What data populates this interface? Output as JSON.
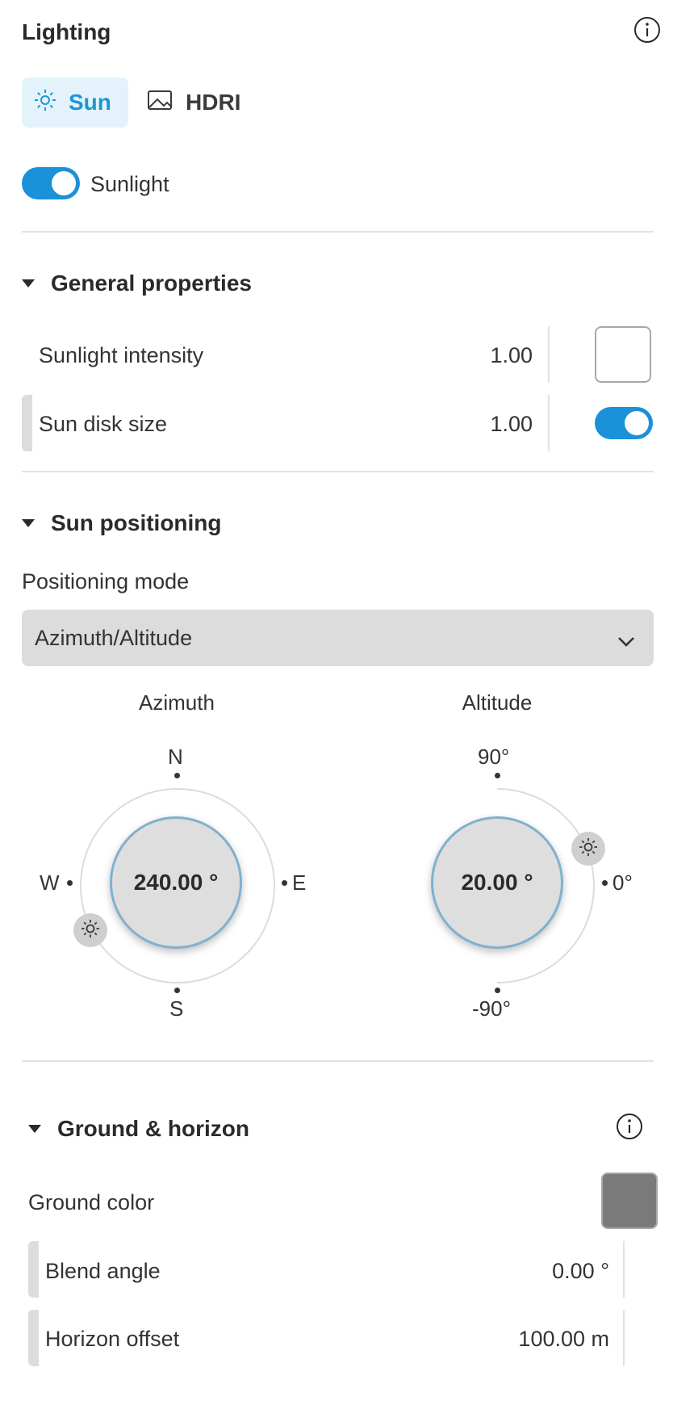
{
  "panel": {
    "title": "Lighting",
    "info_icon": "info-icon"
  },
  "tabs": [
    {
      "label": "Sun",
      "icon": "sun-icon",
      "active": true
    },
    {
      "label": "HDRI",
      "icon": "image-icon",
      "active": false
    }
  ],
  "sunlight_toggle": {
    "label": "Sunlight",
    "on": true
  },
  "general": {
    "title": "General properties",
    "intensity": {
      "label": "Sunlight intensity",
      "value": "1.00",
      "checked": false
    },
    "disk_size": {
      "label": "Sun disk size",
      "value": "1.00",
      "toggle_on": true
    }
  },
  "sun_positioning": {
    "title": "Sun positioning",
    "mode_label": "Positioning mode",
    "mode_value": "Azimuth/Altitude",
    "azimuth": {
      "title": "Azimuth",
      "value": "240.00 °",
      "n": "N",
      "s": "S",
      "e": "E",
      "w": "W"
    },
    "altitude": {
      "title": "Altitude",
      "value": "20.00 °",
      "top": "90°",
      "mid": "0°",
      "bottom": "-90°"
    }
  },
  "ground": {
    "title": "Ground & horizon",
    "info_icon": "info-icon",
    "color_label": "Ground color",
    "color": "#7a7a7a",
    "blend": {
      "label": "Blend angle",
      "value": "0.00 °"
    },
    "horizon": {
      "label": "Horizon offset",
      "value": "100.00 m"
    }
  },
  "colors": {
    "accent": "#1a91d8",
    "tab_bg": "#e4f3fb",
    "knob_ring": "#7fb1cf"
  }
}
